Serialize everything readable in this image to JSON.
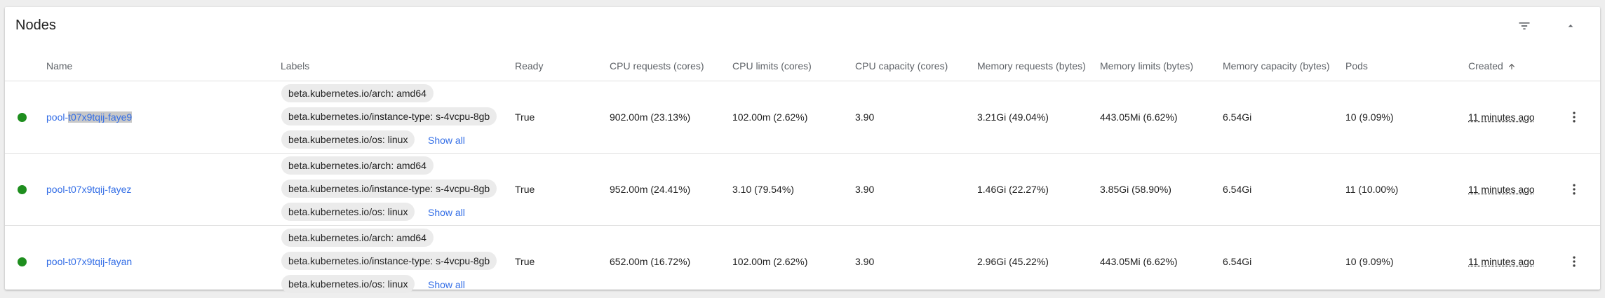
{
  "card": {
    "title": "Nodes",
    "filter_icon": "filter-list-icon",
    "collapse_icon": "chevron-up-icon"
  },
  "columns": {
    "name": "Name",
    "labels": "Labels",
    "ready": "Ready",
    "cpu_requests": "CPU requests (cores)",
    "cpu_limits": "CPU limits (cores)",
    "cpu_capacity": "CPU capacity (cores)",
    "memory_requests": "Memory requests (bytes)",
    "memory_limits": "Memory limits (bytes)",
    "memory_capacity": "Memory capacity (bytes)",
    "pods": "Pods",
    "created": "Created"
  },
  "status_color": "#1e8e1e",
  "link_color": "#326de6",
  "show_all_label": "Show all",
  "rows": [
    {
      "name_prefix": "pool-",
      "name_highlight": "t07x9tqij-faye9",
      "name_suffix": "",
      "labels": [
        "beta.kubernetes.io/arch: amd64",
        "beta.kubernetes.io/instance-type: s-4vcpu-8gb",
        "beta.kubernetes.io/os: linux"
      ],
      "ready": "True",
      "cpu_requests": "902.00m (23.13%)",
      "cpu_limits": "102.00m (2.62%)",
      "cpu_capacity": "3.90",
      "memory_requests": "3.21Gi (49.04%)",
      "memory_limits": "443.05Mi (6.62%)",
      "memory_capacity": "6.54Gi",
      "pods": "10 (9.09%)",
      "created": "11 minutes ago"
    },
    {
      "name_prefix": "pool-t07x9tqij-fayez",
      "name_highlight": "",
      "name_suffix": "",
      "labels": [
        "beta.kubernetes.io/arch: amd64",
        "beta.kubernetes.io/instance-type: s-4vcpu-8gb",
        "beta.kubernetes.io/os: linux"
      ],
      "ready": "True",
      "cpu_requests": "952.00m (24.41%)",
      "cpu_limits": "3.10 (79.54%)",
      "cpu_capacity": "3.90",
      "memory_requests": "1.46Gi (22.27%)",
      "memory_limits": "3.85Gi (58.90%)",
      "memory_capacity": "6.54Gi",
      "pods": "11 (10.00%)",
      "created": "11 minutes ago"
    },
    {
      "name_prefix": "pool-t07x9tqij-fayan",
      "name_highlight": "",
      "name_suffix": "",
      "labels": [
        "beta.kubernetes.io/arch: amd64",
        "beta.kubernetes.io/instance-type: s-4vcpu-8gb",
        "beta.kubernetes.io/os: linux"
      ],
      "ready": "True",
      "cpu_requests": "652.00m (16.72%)",
      "cpu_limits": "102.00m (2.62%)",
      "cpu_capacity": "3.90",
      "memory_requests": "2.96Gi (45.22%)",
      "memory_limits": "443.05Mi (6.62%)",
      "memory_capacity": "6.54Gi",
      "pods": "10 (9.09%)",
      "created": "11 minutes ago"
    }
  ]
}
